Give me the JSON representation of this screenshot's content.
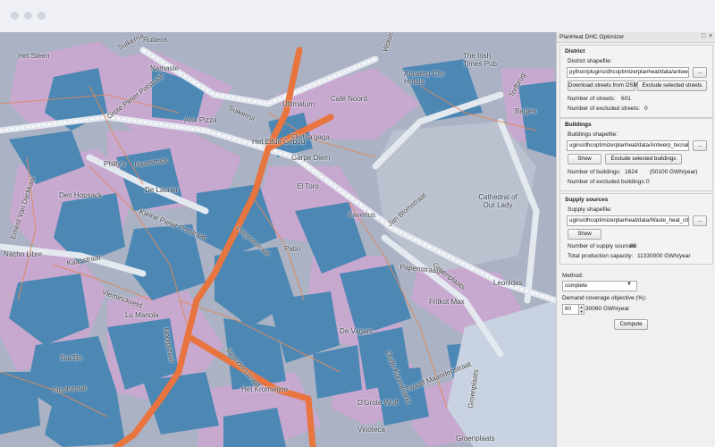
{
  "window": {
    "title": "PlanHeat DHC Optimizer"
  },
  "map": {
    "street_labels": [
      "Suikerrui",
      "Grote Pieter Potstraat",
      "Haarstraat",
      "Kleine Pieter Potstraat",
      "Ernest Van Dijckkaai",
      "Kaasstraat",
      "Hoogstraat",
      "Pelgrimstraat",
      "Reyndersstraat",
      "Vleminckveld",
      "Stoofstraat",
      "Papenstraatje",
      "Oude Koornmarkt",
      "Jan Blomstraat",
      "Groenplaats",
      "Twaalf Maandenstraat",
      "Wolstraat",
      "Torfbrug",
      "Groenplaats"
    ],
    "poi_labels": [
      "Het Steen",
      "Rubens",
      "Namaste",
      "Arte Pizza",
      "Philly's",
      "Den Hopsack",
      "De Laurier",
      "Nacho Libre",
      "Ultimatum",
      "Café Noord",
      "Flish a'gaga",
      "Garpe Diem",
      "Het Elfde Gebod",
      "El Toro",
      "Xaverius",
      "Patio",
      "Antwerp City Hotels",
      "The Irish Times Pub",
      "Bagles",
      "Cathedral of Our Lady",
      "Leonidas",
      "Fritkot Max",
      "Lu Manola",
      "Bar'Bo",
      "De Vagant",
      "Groenplaats",
      "Het Kromwijne",
      "D'Grote Wolf",
      "Vinoteca"
    ]
  },
  "panel": {
    "district": {
      "title": "District",
      "shapefile_label": "District shapefile:",
      "shapefile_value": "python/plugins/dhcoptimizerplanheat/data/antwerp.shp",
      "browse_label": "...",
      "download_button": "Download streets from OSM",
      "exclude_button": "Exclude selected streets",
      "num_streets_label": "Number of streets:",
      "num_streets_value": "601",
      "num_excluded_label": "Number of excluded streets:",
      "num_excluded_value": "0"
    },
    "buildings": {
      "title": "Buildings",
      "shapefile_label": "Buildings shapefile:",
      "shapefile_value": "ugins/dhcoptimizerplanheat/data/Antwerp_tecnalia.shp",
      "browse_label": "...",
      "show_button": "Show",
      "exclude_button": "Exclude selected buildings",
      "num_buildings_label": "Number of buildings:",
      "num_buildings_value": "1624",
      "demand_value": "(50100 GWh/year)",
      "num_excluded_label": "Number of excluded buildings:",
      "num_excluded_value": "0"
    },
    "supply": {
      "title": "Supply sources",
      "shapefile_label": "Supply shapefile:",
      "shapefile_value": "ugins/dhcoptimizerplanheat/data/Waste_heat_city.shp",
      "browse_label": "...",
      "show_button": "Show",
      "num_sources_label": "Number of supply sources:",
      "num_sources_value": "86",
      "capacity_label": "Total production capacity:",
      "capacity_value": "11330000 GWh/year"
    },
    "method_label": "Method:",
    "method_value": "complete",
    "coverage_label": "Demand coverage objective (%):",
    "coverage_value": "60",
    "coverage_result": "30060 GWh/year",
    "compute_button": "Compute"
  }
}
